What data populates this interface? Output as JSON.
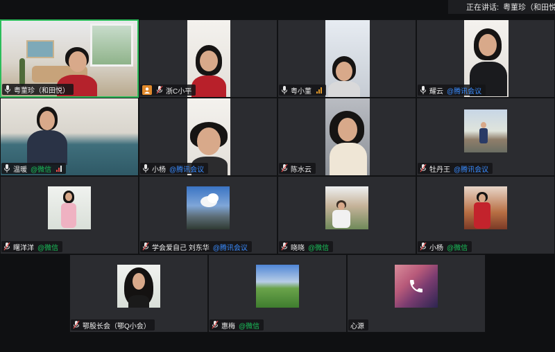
{
  "speaking": {
    "label": "正在讲话:",
    "names": "粤菫珍（和田悦"
  },
  "tiles": [
    {
      "name": "粤菫珍（和田悦）",
      "suffix": ""
    },
    {
      "name": "浙C小平",
      "suffix": ""
    },
    {
      "name": "粤小菫",
      "suffix": ""
    },
    {
      "name": "耀云",
      "suffix": "@腾讯会议"
    },
    {
      "name": "温暖",
      "suffix": "@微信"
    },
    {
      "name": "小杨",
      "suffix": "@腾讯会议"
    },
    {
      "name": "陈水云",
      "suffix": ""
    },
    {
      "name": "牡丹王",
      "suffix": "@腾讯会议"
    },
    {
      "name": "曙洋洋",
      "suffix": "@微信"
    },
    {
      "name": "学会爱自己 刘东华",
      "suffix": "@腾讯会议"
    },
    {
      "name": "晓晓",
      "suffix": "@微信"
    },
    {
      "name": "小杨",
      "suffix": "@微信"
    },
    {
      "name": "鄂股长会（鄂Q小会）",
      "suffix": ""
    },
    {
      "name": "惠梅",
      "suffix": "@微信"
    },
    {
      "name": "心源",
      "suffix": ""
    }
  ],
  "colors": {
    "wechat": "#19c25b",
    "tencent": "#3a8cff",
    "active": "#2bbd5a",
    "tile_bg": "#2b2c30"
  }
}
